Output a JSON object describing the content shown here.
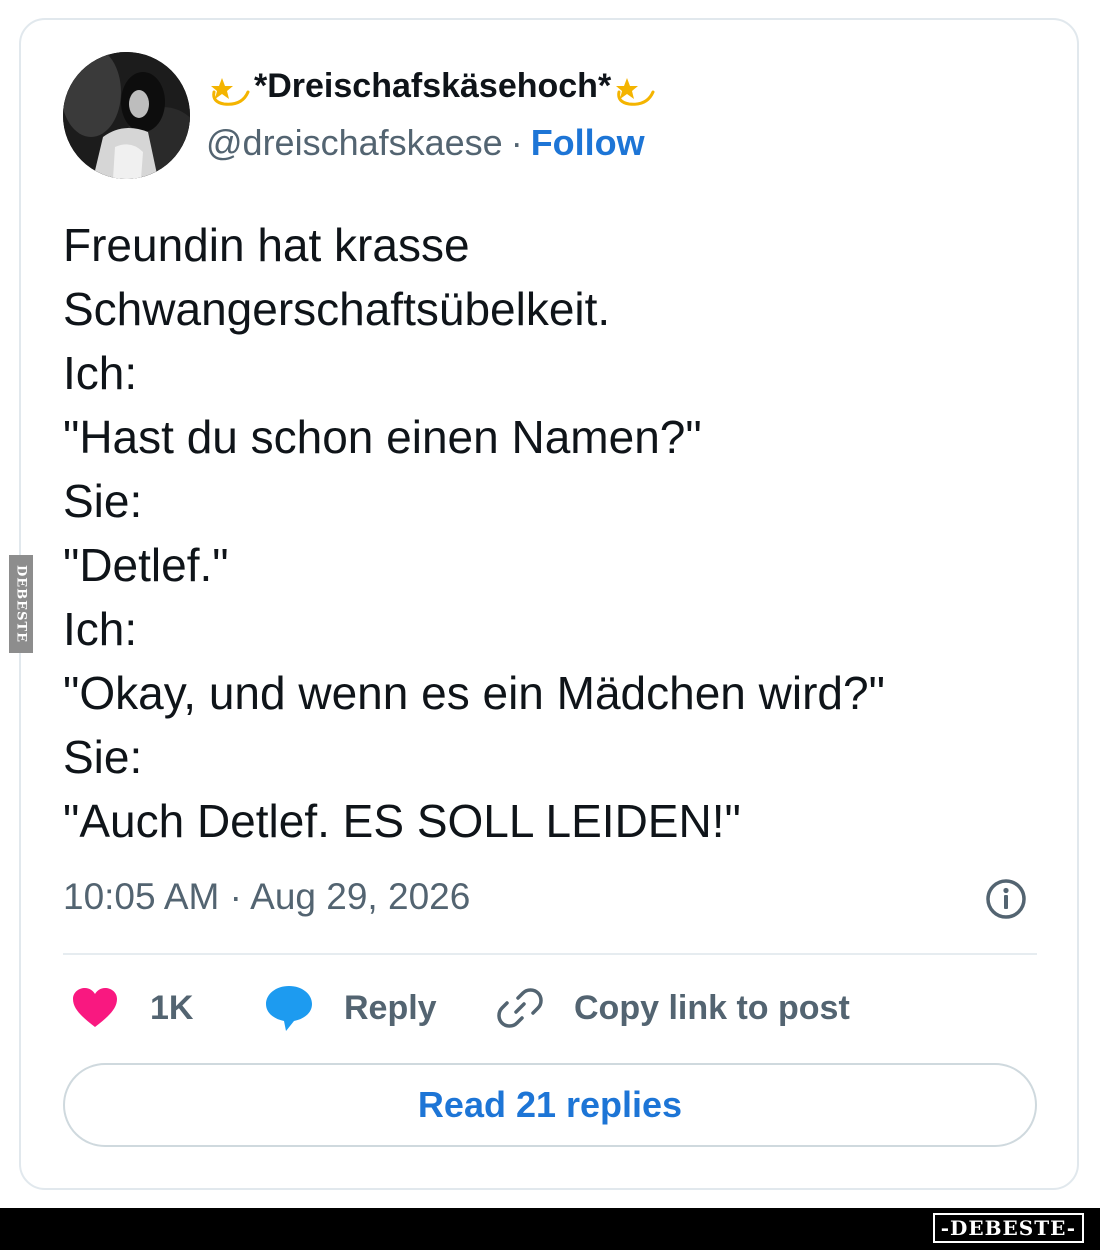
{
  "post": {
    "author": {
      "display_name": "*Dreischafskäsehoch*",
      "leading_emoji": "dizzy-star-emoji",
      "trailing_emoji": "dizzy-star-emoji",
      "handle": "@dreischafskaese",
      "separator": "·",
      "follow_label": "Follow"
    },
    "text_lines": [
      "Freundin hat krasse",
      "Schwangerschaftsübelkeit.",
      "Ich:",
      "\"Hast du schon einen Namen?\"",
      "Sie:",
      "\"Detlef.\"",
      "Ich:",
      "\"Okay, und wenn es ein Mädchen wird?\"",
      "Sie:",
      "\"Auch Detlef. ES SOLL LEIDEN!\""
    ],
    "timestamp": "10:05 AM · Aug 29, 2026",
    "info_icon": "info-circle-icon",
    "actions": {
      "like_count": "1K",
      "reply_label": "Reply",
      "copy_link_label": "Copy link to post"
    },
    "read_replies_label": "Read 21 replies"
  },
  "watermarks": {
    "side": "DEBESTE",
    "footer": "-DEBESTE-"
  },
  "colors": {
    "link_blue": "#1d75d6",
    "heart_pink": "#f91880",
    "reply_blue": "#1d9bf0",
    "muted_gray": "#536471",
    "text_dark": "#0f1419",
    "border": "#e1e8ed"
  }
}
